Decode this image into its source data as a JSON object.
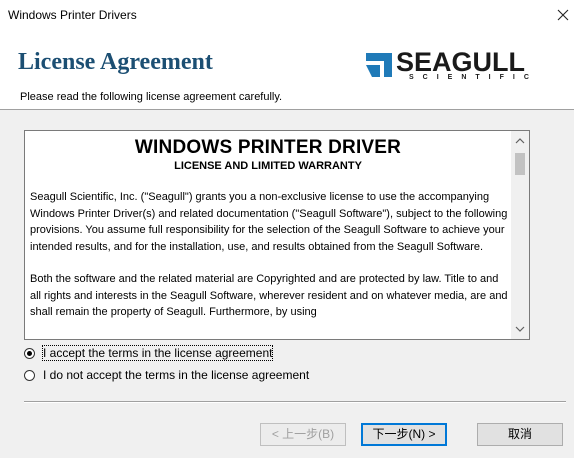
{
  "window": {
    "title": "Windows Printer Drivers",
    "close_glyph": "✕"
  },
  "header": {
    "title": "License Agreement",
    "subtitle": "Please read the following license agreement carefully.",
    "logo": {
      "brand": "SEAGULL",
      "tagline": "SCIENTIFIC"
    }
  },
  "license": {
    "heading": "WINDOWS PRINTER DRIVER",
    "subheading": "LICENSE AND LIMITED WARRANTY",
    "paragraphs": [
      "Seagull Scientific, Inc. (\"Seagull\") grants you a non-exclusive license to use the accompanying Windows Printer Driver(s) and related documentation (\"Seagull Software\"), subject to the following provisions.  You assume full responsibility for the selection of the Seagull Software to achieve your intended results, and for the installation, use, and results obtained from the Seagull Software.",
      "Both the software and the related material are Copyrighted and are protected by law. Title to and all rights and interests in the Seagull Software, wherever resident and on whatever media, are and shall remain the property of Seagull.  Furthermore, by using"
    ],
    "scroll_up_glyph": "▲",
    "scroll_down_glyph": "▼"
  },
  "options": {
    "accept_label": "I accept the terms in the license agreement",
    "decline_label": "I do not accept the terms in the license agreement",
    "selected": "accept"
  },
  "buttons": {
    "back": "< 上一步(B)",
    "next": "下一步(N) >",
    "cancel": "取消"
  },
  "colors": {
    "header_title": "#1c4f73",
    "logo_mark": "#1f7ab8",
    "focus_border": "#0078d7"
  }
}
